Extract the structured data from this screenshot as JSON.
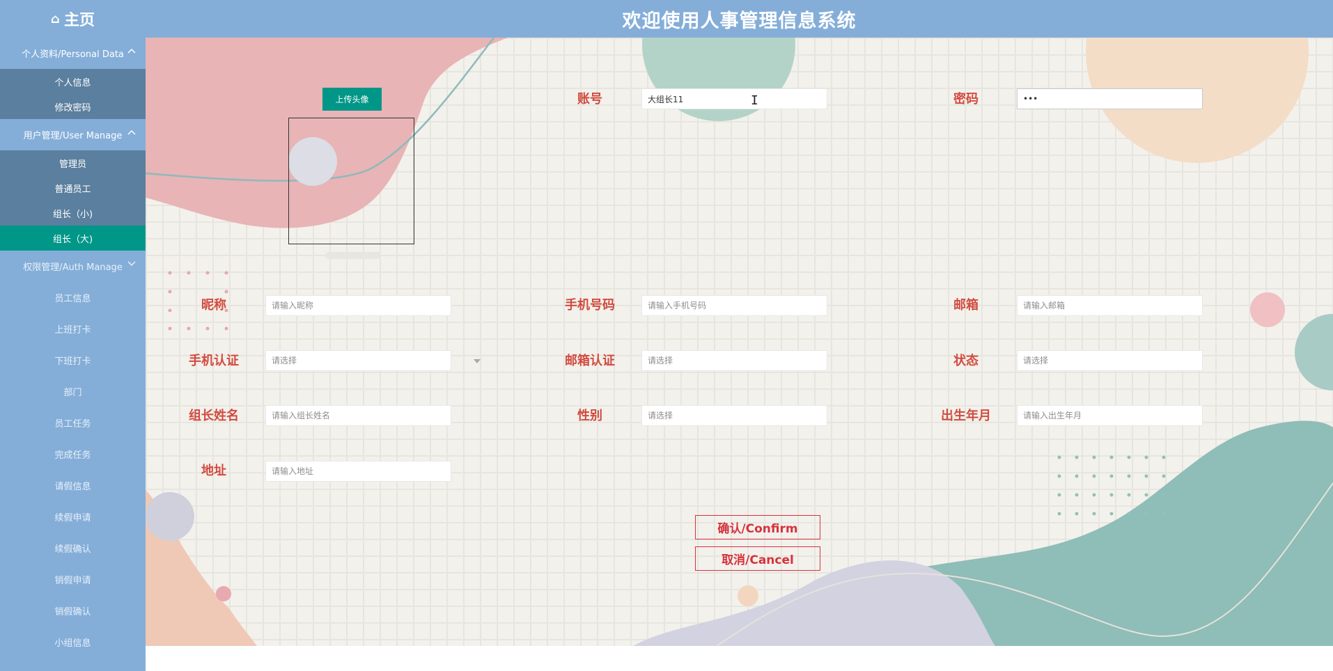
{
  "header": {
    "home_icon": "home-icon",
    "home_icon_glyph": "⌂",
    "home_label": "主页",
    "title": "欢迎使用人事管理信息系统"
  },
  "sidebar": {
    "groups": [
      {
        "label": "个人资料/Personal Data",
        "expanded": true,
        "items": [
          "个人信息",
          "修改密码"
        ]
      },
      {
        "label": "用户管理/User Manage",
        "expanded": true,
        "items": [
          "管理员",
          "普通员工",
          "组长（小)",
          "组长（大)"
        ],
        "active_index": 3
      },
      {
        "label": "权限管理/Auth Manage",
        "expanded": false
      }
    ],
    "menu_items": [
      "员工信息",
      "上班打卡",
      "下班打卡",
      "部门",
      "员工任务",
      "完成任务",
      "请假信息",
      "续假申请",
      "续假确认",
      "销假申请",
      "销假确认",
      "小组信息"
    ]
  },
  "form": {
    "upload_label": "上传头像",
    "account": {
      "label": "账号",
      "value": "大组长11"
    },
    "password": {
      "label": "密码",
      "value": "123"
    },
    "nickname": {
      "label": "昵称",
      "placeholder": "请输入昵称"
    },
    "phone": {
      "label": "手机号码",
      "placeholder": "请输入手机号码"
    },
    "email": {
      "label": "邮箱",
      "placeholder": "请输入邮箱"
    },
    "phone_verify": {
      "label": "手机认证",
      "placeholder": "请选择"
    },
    "email_verify": {
      "label": "邮箱认证",
      "placeholder": "请选择"
    },
    "status": {
      "label": "状态",
      "placeholder": "请选择"
    },
    "leader_name": {
      "label": "组长姓名",
      "placeholder": "请输入组长姓名"
    },
    "gender": {
      "label": "性别",
      "placeholder": "请选择"
    },
    "birth": {
      "label": "出生年月",
      "placeholder": "请输入出生年月"
    },
    "address": {
      "label": "地址",
      "placeholder": "请输入地址"
    },
    "confirm_label": "确认/Confirm",
    "cancel_label": "取消/Cancel"
  },
  "colors": {
    "topbar": "#84aed8",
    "sidebar_sub": "#5b7f9e",
    "active": "#009688",
    "label_red": "#d24b3f",
    "button_red": "#d6323c"
  }
}
